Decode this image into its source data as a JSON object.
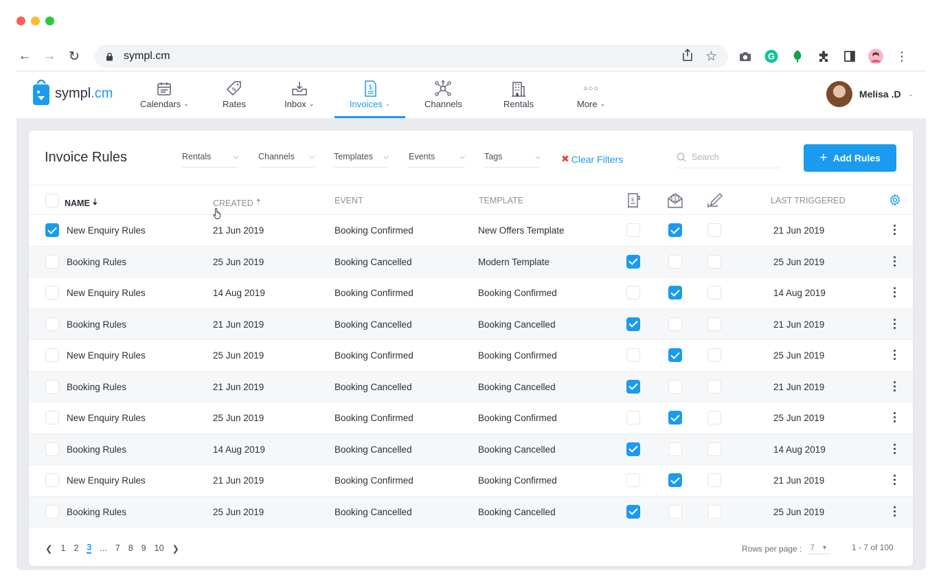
{
  "browser": {
    "url": "sympl.cm",
    "traffic_colors": [
      "#ff5f57",
      "#febc2e",
      "#28c840"
    ]
  },
  "app": {
    "logo_prefix": "sympl",
    "logo_suffix": ".cm",
    "nav": [
      {
        "label": "Calendars",
        "icon": "calendar-icon",
        "dropdown": true
      },
      {
        "label": "Rates",
        "icon": "price-tag-icon",
        "dropdown": false
      },
      {
        "label": "Inbox",
        "icon": "inbox-icon",
        "dropdown": true
      },
      {
        "label": "Invoices",
        "icon": "invoice-icon",
        "dropdown": true,
        "active": true
      },
      {
        "label": "Channels",
        "icon": "network-icon",
        "dropdown": false
      },
      {
        "label": "Rentals",
        "icon": "building-icon",
        "dropdown": false
      },
      {
        "label": "More",
        "icon": "more-dots-icon",
        "dropdown": true
      }
    ],
    "user_name": "Melisa .D",
    "accent": "#1a9bf0"
  },
  "toolbar": {
    "title": "Invoice Rules",
    "filters": [
      "Rentals",
      "Channels",
      "Templates",
      "Events",
      "Tags"
    ],
    "clear_filters": "Clear Filters",
    "search_placeholder": "Search",
    "add_button": "Add Rules"
  },
  "table": {
    "headers": {
      "name": "NAME",
      "created": "CREATED",
      "event": "EVENT",
      "template": "TEMPLATE",
      "last_triggered": "LAST TRIGGERED"
    },
    "rows": [
      {
        "selected": true,
        "name": "New Enquiry Rules",
        "created": "21 Jun 2019",
        "event": "Booking Confirmed",
        "template": "New Offers Template",
        "c1": false,
        "c2": true,
        "c3": false,
        "last": "21 Jun 2019"
      },
      {
        "selected": false,
        "name": "Booking Rules",
        "created": "25 Jun 2019",
        "event": "Booking Cancelled",
        "template": "Modern Template",
        "c1": true,
        "c2": false,
        "c3": false,
        "last": "25 Jun 2019"
      },
      {
        "selected": false,
        "name": "New Enquiry Rules",
        "created": "14 Aug 2019",
        "event": "Booking Confirmed",
        "template": "Booking Confirmed",
        "c1": false,
        "c2": true,
        "c3": false,
        "last": "14 Aug 2019"
      },
      {
        "selected": false,
        "name": "Booking Rules",
        "created": "21 Jun 2019",
        "event": "Booking Cancelled",
        "template": "Booking Cancelled",
        "c1": true,
        "c2": false,
        "c3": false,
        "last": "21 Jun 2019"
      },
      {
        "selected": false,
        "name": "New Enquiry Rules",
        "created": "25 Jun 2019",
        "event": "Booking Confirmed",
        "template": "Booking Confirmed",
        "c1": false,
        "c2": true,
        "c3": false,
        "last": "25 Jun 2019"
      },
      {
        "selected": false,
        "name": "Booking Rules",
        "created": "21 Jun 2019",
        "event": "Booking Cancelled",
        "template": "Booking Cancelled",
        "c1": true,
        "c2": false,
        "c3": false,
        "last": "21 Jun 2019"
      },
      {
        "selected": false,
        "name": "New Enquiry Rules",
        "created": "25 Jun 2019",
        "event": "Booking Confirmed",
        "template": "Booking Confirmed",
        "c1": false,
        "c2": true,
        "c3": false,
        "last": "25 Jun 2019"
      },
      {
        "selected": false,
        "name": "Booking Rules",
        "created": "14 Aug 2019",
        "event": "Booking Cancelled",
        "template": "Booking Cancelled",
        "c1": true,
        "c2": false,
        "c3": false,
        "last": "14 Aug 2019"
      },
      {
        "selected": false,
        "name": "New Enquiry Rules",
        "created": "21 Jun 2019",
        "event": "Booking Confirmed",
        "template": "Booking Confirmed",
        "c1": false,
        "c2": true,
        "c3": false,
        "last": "21 Jun 2019"
      },
      {
        "selected": false,
        "name": "Booking Rules",
        "created": "25 Jun 2019",
        "event": "Booking Cancelled",
        "template": "Booking Cancelled",
        "c1": true,
        "c2": false,
        "c3": false,
        "last": "25 Jun 2019"
      }
    ]
  },
  "pagination": {
    "pages": [
      "1",
      "2",
      "3",
      "...",
      "7",
      "8",
      "9",
      "10"
    ],
    "current": "3",
    "rows_per_page_label": "Rows per page :",
    "rows_per_page": "7",
    "range": "1 - 7 of 100"
  }
}
